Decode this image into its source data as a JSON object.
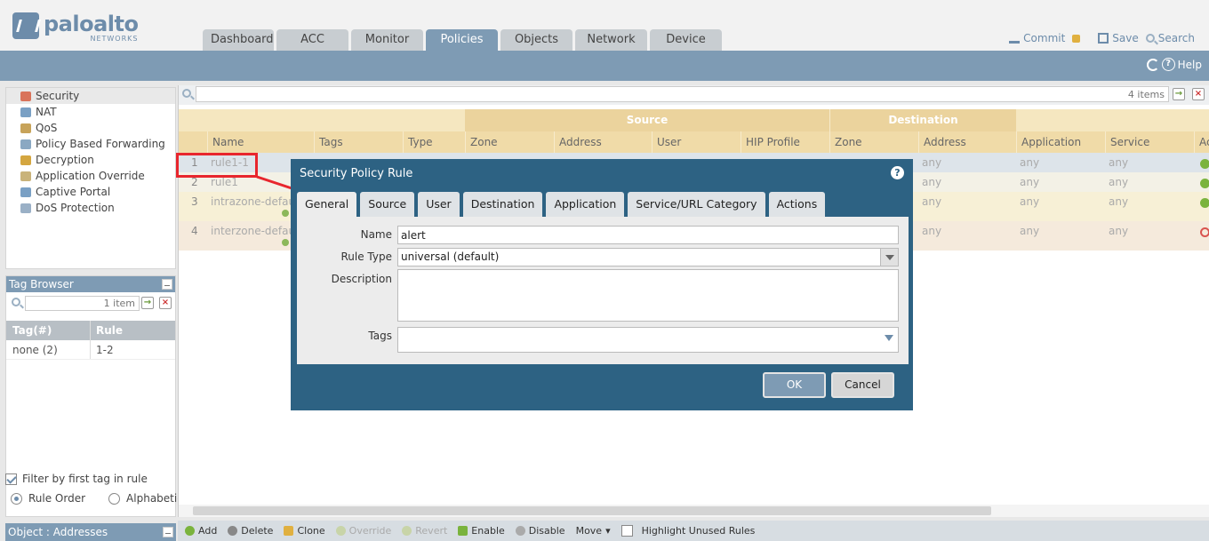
{
  "app": {
    "logo_main": "paloalto",
    "logo_sub": "NETWORKS"
  },
  "tabs": [
    "Dashboard",
    "ACC",
    "Monitor",
    "Policies",
    "Objects",
    "Network",
    "Device"
  ],
  "active_tab": "Policies",
  "top_actions": {
    "commit": "Commit",
    "save": "Save",
    "search": "Search",
    "help": "Help"
  },
  "leftnav": {
    "items": [
      "Security",
      "NAT",
      "QoS",
      "Policy Based Forwarding",
      "Decryption",
      "Application Override",
      "Captive Portal",
      "DoS Protection"
    ],
    "active": "Security"
  },
  "tag_browser": {
    "title": "Tag Browser",
    "search_count": "1 item",
    "col_tag": "Tag(#)",
    "col_rule": "Rule",
    "rows": [
      {
        "tag": "none (2)",
        "rule": "1-2"
      }
    ],
    "filter_label": "Filter by first tag in rule",
    "radio_rule_order": "Rule Order",
    "radio_alpha": "Alphabetical"
  },
  "object_panel": {
    "title": "Object : Addresses"
  },
  "main": {
    "search_count": "4 items",
    "group_source": "Source",
    "group_destination": "Destination",
    "columns": {
      "name": "Name",
      "tags": "Tags",
      "type": "Type",
      "src_zone": "Zone",
      "src_address": "Address",
      "src_user": "User",
      "src_hip": "HIP Profile",
      "dst_zone": "Zone",
      "dst_address": "Address",
      "application": "Application",
      "service": "Service",
      "action": "Ac"
    },
    "rows": [
      {
        "num": "1",
        "name": "rule1-1",
        "dst_address": "any",
        "application": "any",
        "service": "any"
      },
      {
        "num": "2",
        "name": "rule1",
        "dst_address": "any",
        "application": "any",
        "service": "any"
      },
      {
        "num": "3",
        "name": "intrazone-default",
        "dst_address": "any",
        "application": "any",
        "service": "any"
      },
      {
        "num": "4",
        "name": "interzone-default",
        "dst_address": "any",
        "application": "any",
        "service": "any"
      }
    ]
  },
  "bottom_bar": {
    "add": "Add",
    "delete": "Delete",
    "clone": "Clone",
    "override": "Override",
    "revert": "Revert",
    "enable": "Enable",
    "disable": "Disable",
    "move": "Move",
    "highlight": "Highlight Unused Rules"
  },
  "modal": {
    "title": "Security Policy Rule",
    "tabs": [
      "General",
      "Source",
      "User",
      "Destination",
      "Application",
      "Service/URL Category",
      "Actions"
    ],
    "active_tab": "General",
    "name_label": "Name",
    "name_value": "alert",
    "rule_type_label": "Rule Type",
    "rule_type_value": "universal (default)",
    "description_label": "Description",
    "description_value": "",
    "tags_label": "Tags",
    "ok": "OK",
    "cancel": "Cancel"
  },
  "colors": {
    "accent": "#7e9bb4",
    "modal_bg": "#2d6283",
    "header_tan": "#ebd39d",
    "highlight_red": "#e8262d",
    "allow_green": "#7ab33d",
    "deny_red": "#d9534f"
  },
  "icons": {
    "search": "search-icon",
    "refresh": "refresh-icon",
    "help": "help-icon",
    "commit": "commit-icon",
    "save": "save-icon",
    "lock": "lock-icon"
  }
}
